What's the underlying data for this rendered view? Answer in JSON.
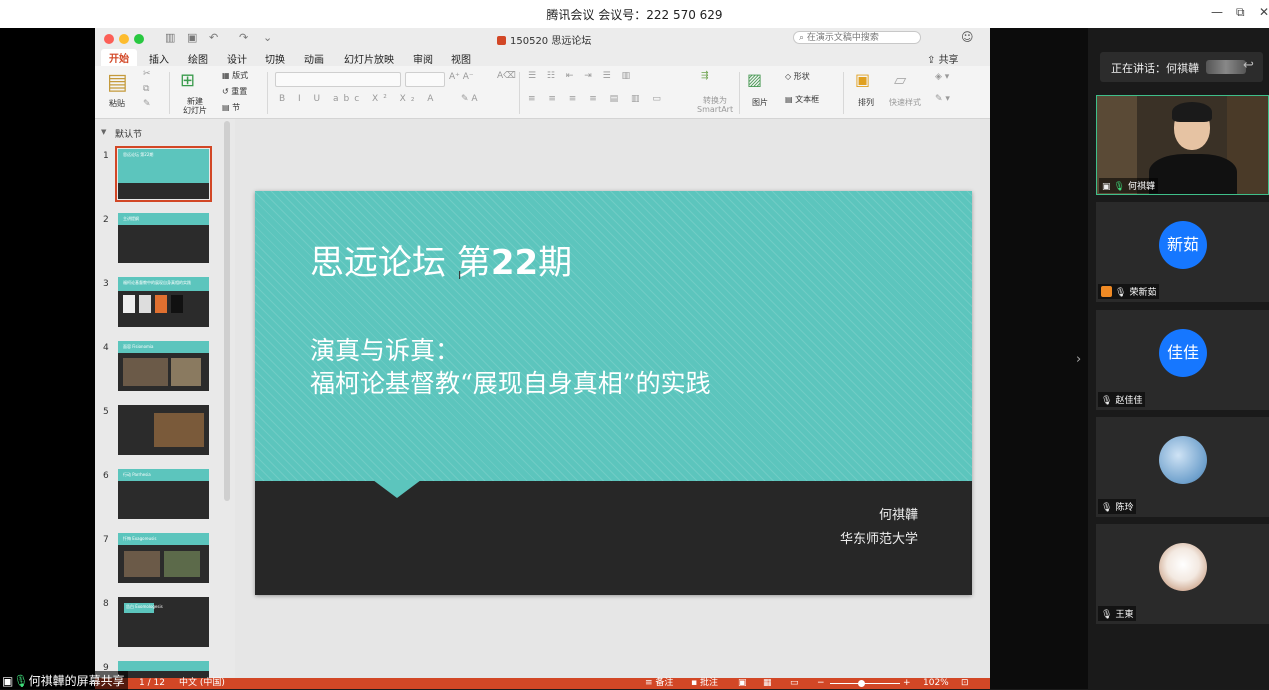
{
  "meeting_bar": {
    "title": "腾讯会议 会议号：222 570 629",
    "minimize": "—",
    "restore": "⧉",
    "close": "✕"
  },
  "ppt": {
    "doc_title": "150520 思远论坛",
    "search_placeholder": "在演示文稿中搜索",
    "share_label": "共享",
    "tabs": [
      "开始",
      "插入",
      "绘图",
      "设计",
      "切换",
      "动画",
      "幻灯片放映",
      "审阅",
      "视图"
    ],
    "ribbon": {
      "paste": "粘贴",
      "new_slide": "新建\n幻灯片",
      "layout": "版式",
      "reset": "重置",
      "section": "节",
      "convert_smartart": "转换为\nSmartArt",
      "picture": "图片",
      "shape": "形状",
      "textbox": "文本框",
      "arrange": "排列",
      "quick_styles": "快速样式"
    },
    "section_name": "默认节",
    "thumb_numbers": [
      "1",
      "2",
      "3",
      "4",
      "5",
      "6",
      "7",
      "8",
      "9"
    ],
    "thumb_titles": [
      "思远论坛 第22期",
      "主讲提纲",
      "福柯论基督教中的展现自身真相的实践",
      "面容 Fisionomia",
      "",
      "行动 Parrhesia",
      "忏悔 Exagoreusis",
      "告白 Exomologesis",
      ""
    ],
    "slide": {
      "title_prefix": "思远论坛 第",
      "title_number": "22",
      "title_suffix": "期",
      "subtitle_line1": "演真与诉真：",
      "subtitle_line2": "福柯论基督教“展现自身真相”的实践",
      "author": "何祺韡",
      "affiliation": "华东师范大学"
    },
    "status": {
      "slide_counter": "1 / 12",
      "language": "中文 (中国)",
      "notes": "备注",
      "comments": "批注",
      "zoom": "102%"
    }
  },
  "participants": {
    "speaking_label": "正在讲话：何祺韡",
    "tiles": [
      {
        "name": "何祺韡",
        "avatar_text": ""
      },
      {
        "name": "荣新茹",
        "avatar_text": "新茹"
      },
      {
        "name": "赵佳佳",
        "avatar_text": "佳佳"
      },
      {
        "name": "陈玲",
        "avatar_text": ""
      },
      {
        "name": "王東",
        "avatar_text": ""
      }
    ]
  },
  "screen_share_label": "何祺韡的屏幕共享",
  "colors": {
    "accent_orange": "#d24726",
    "slide_teal": "#5cc5bd",
    "slide_dark": "#272727",
    "avatar_blue": "#1677ff",
    "speaking_green": "#3fbf8a"
  }
}
